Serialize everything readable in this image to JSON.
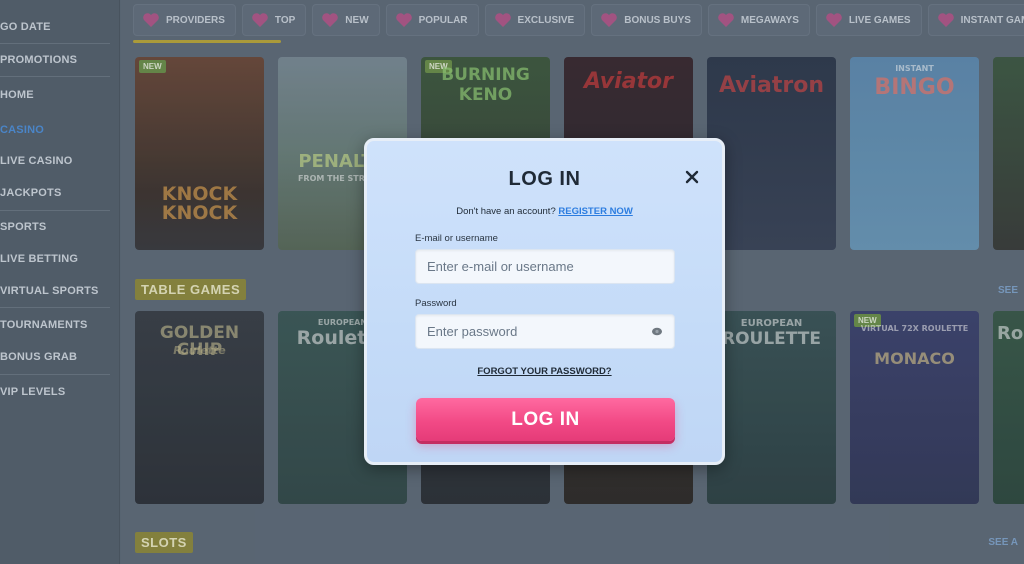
{
  "sidebar": {
    "items": [
      {
        "label": "GO DATE"
      },
      {
        "label": "PROMOTIONS"
      },
      {
        "label": "HOME"
      },
      {
        "label": "CASINO"
      },
      {
        "label": "LIVE CASINO"
      },
      {
        "label": "JACKPOTS"
      },
      {
        "label": "SPORTS"
      },
      {
        "label": "LIVE BETTING"
      },
      {
        "label": "VIRTUAL SPORTS"
      },
      {
        "label": "TOURNAMENTS"
      },
      {
        "label": "BONUS GRAB"
      },
      {
        "label": "VIP LEVELS"
      }
    ],
    "active_item": "CASINO"
  },
  "tabs": [
    {
      "label": "PROVIDERS"
    },
    {
      "label": "TOP"
    },
    {
      "label": "NEW"
    },
    {
      "label": "POPULAR"
    },
    {
      "label": "EXCLUSIVE"
    },
    {
      "label": "BONUS BUYS"
    },
    {
      "label": "MEGAWAYS"
    },
    {
      "label": "LIVE GAMES"
    },
    {
      "label": "INSTANT GAMES"
    }
  ],
  "row1": {
    "games": [
      {
        "title": "KNOCK KNOCK",
        "badge": "NEW"
      },
      {
        "title": "PENALTY",
        "subtitle": "FROM THE STREETS"
      },
      {
        "title": "BURNING KENO",
        "badge": "NEW"
      },
      {
        "title": "Aviator"
      },
      {
        "title": "Aviatron"
      },
      {
        "title": "BINGO",
        "subtitle": "INSTANT"
      },
      {
        "title": ""
      }
    ]
  },
  "table_games": {
    "title": "TABLE GAMES",
    "see_all": "SEE",
    "games": [
      {
        "title": "GOLDEN CHIP",
        "subtitle": "Roulette"
      },
      {
        "title": "Roulette",
        "subtitle": "EUROPEAN"
      },
      {
        "title": ""
      },
      {
        "title": ""
      },
      {
        "title": "ROULETTE",
        "subtitle": "EUROPEAN"
      },
      {
        "title": "MONACO",
        "subtitle": "VIRTUAL 72x ROULETTE",
        "badge": "NEW"
      },
      {
        "title": "Ro"
      }
    ]
  },
  "slots": {
    "title": "SLOTS",
    "see_all": "SEE A"
  },
  "modal": {
    "title": "LOG IN",
    "signup_prompt": "Don't have an account?",
    "signup_link": "REGISTER NOW",
    "email_label": "E-mail or username",
    "email_placeholder": "Enter e-mail or username",
    "email_value": "",
    "password_label": "Password",
    "password_placeholder": "Enter password",
    "password_value": "",
    "forgot_link": "FORGOT YOUR PASSWORD?",
    "submit_label": "LOG IN"
  },
  "colors": {
    "accent_pink": "#f24a86",
    "link_blue": "#2c7de0",
    "active_nav": "#4f8fd8"
  }
}
